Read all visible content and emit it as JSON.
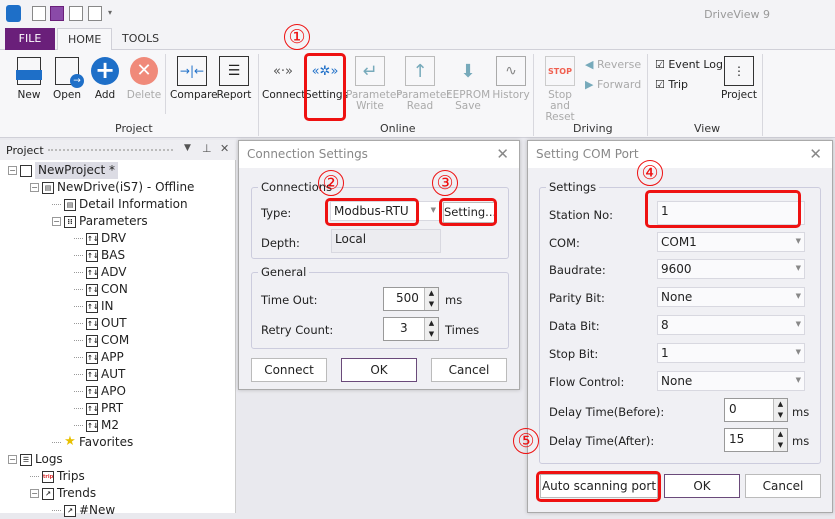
{
  "app": {
    "title": "DriveView 9"
  },
  "tabs": [
    {
      "label": "FILE"
    },
    {
      "label": "HOME"
    },
    {
      "label": "TOOLS"
    }
  ],
  "ribbon": {
    "project": {
      "label": "Project",
      "buttons": [
        {
          "label": "New"
        },
        {
          "label": "Open"
        },
        {
          "label": "Add"
        },
        {
          "label": "Delete"
        },
        {
          "label": "Compare"
        },
        {
          "label": "Report"
        }
      ]
    },
    "online": {
      "label": "Online",
      "buttons": [
        {
          "label": "Connect"
        },
        {
          "label": "Settings"
        },
        {
          "label": "Parameter Write"
        },
        {
          "label": "Parameter Read"
        },
        {
          "label": "EEPROM Save"
        },
        {
          "label": "History"
        }
      ]
    },
    "driving": {
      "label": "Driving",
      "stop": "Stop and Reset",
      "stop_icon_text": "STOP",
      "reverse": "Reverse",
      "forward": "Forward"
    },
    "view": {
      "label": "View",
      "event_log": "Event Log",
      "event_log_checked": true,
      "trip": "Trip",
      "trip_checked": true,
      "project": "Project"
    }
  },
  "panel": {
    "title": "Project",
    "tree": [
      {
        "label": "NewProject *",
        "level": 0,
        "icon": "document-icon",
        "selected": true
      },
      {
        "label": "NewDrive(iS7) - Offline",
        "level": 1,
        "icon": "drive-icon"
      },
      {
        "label": "Detail Information",
        "level": 2,
        "icon": "drive-icon"
      },
      {
        "label": "Parameters",
        "level": 2,
        "icon": "parameters-icon"
      },
      {
        "label": "DRV",
        "level": 3,
        "icon": "param-group-icon"
      },
      {
        "label": "BAS",
        "level": 3,
        "icon": "param-group-icon"
      },
      {
        "label": "ADV",
        "level": 3,
        "icon": "param-group-icon"
      },
      {
        "label": "CON",
        "level": 3,
        "icon": "param-group-icon"
      },
      {
        "label": "IN",
        "level": 3,
        "icon": "param-group-icon"
      },
      {
        "label": "OUT",
        "level": 3,
        "icon": "param-group-icon"
      },
      {
        "label": "COM",
        "level": 3,
        "icon": "param-group-icon"
      },
      {
        "label": "APP",
        "level": 3,
        "icon": "param-group-icon"
      },
      {
        "label": "AUT",
        "level": 3,
        "icon": "param-group-icon"
      },
      {
        "label": "APO",
        "level": 3,
        "icon": "param-group-icon"
      },
      {
        "label": "PRT",
        "level": 3,
        "icon": "param-group-icon"
      },
      {
        "label": "M2",
        "level": 3,
        "icon": "param-group-icon"
      },
      {
        "label": "Favorites",
        "level": 2,
        "icon": "star-icon"
      },
      {
        "label": "Logs",
        "level": 0,
        "icon": "logs-icon"
      },
      {
        "label": "Trips",
        "level": 1,
        "icon": "trip-icon"
      },
      {
        "label": "Trends",
        "level": 1,
        "icon": "trend-icon"
      },
      {
        "label": "#New",
        "level": 2,
        "icon": "trend-icon"
      }
    ]
  },
  "conn": {
    "title": "Connection Settings",
    "connections": "Connections",
    "type_label": "Type:",
    "type_value": "Modbus-RTU",
    "setting_button": "Setting...",
    "depth_label": "Depth:",
    "depth_value": "Local",
    "general": "General",
    "timeout_label": "Time Out:",
    "timeout_value": "500",
    "timeout_unit": "ms",
    "retry_label": "Retry Count:",
    "retry_value": "3",
    "retry_unit": "Times",
    "connect": "Connect",
    "ok": "OK",
    "cancel": "Cancel"
  },
  "com": {
    "title": "Setting COM Port",
    "settings": "Settings",
    "rows": [
      {
        "label": "Station No:",
        "value": "1"
      },
      {
        "label": "COM:",
        "value": "COM1"
      },
      {
        "label": "Baudrate:",
        "value": "9600"
      },
      {
        "label": "Parity Bit:",
        "value": "None"
      },
      {
        "label": "Data Bit:",
        "value": "8"
      },
      {
        "label": "Stop Bit:",
        "value": "1"
      },
      {
        "label": "Flow Control:",
        "value": "None"
      }
    ],
    "delay_before_label": "Delay Time(Before):",
    "delay_before_value": "0",
    "delay_after_label": "Delay Time(After):",
    "delay_after_value": "15",
    "unit": "ms",
    "auto_scan": "Auto scanning port",
    "ok": "OK",
    "cancel": "Cancel"
  },
  "annotations": [
    "①",
    "②",
    "③",
    "④",
    "⑤"
  ],
  "colors": {
    "file_tab": "#6a1f7a",
    "annotation": "#ee1111",
    "accent_blue": "#1e6fc8"
  }
}
